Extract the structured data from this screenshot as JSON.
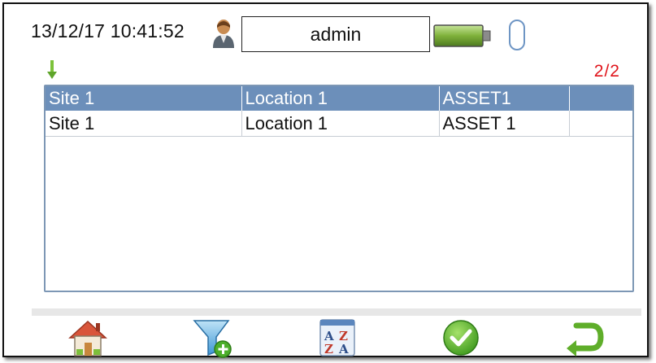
{
  "status_bar": {
    "datetime": "13/12/17 10:41:52",
    "username": "admin",
    "icons": [
      "user-icon",
      "battery-icon",
      "signal-icon"
    ]
  },
  "list": {
    "page_indicator": "2/2",
    "columns": [
      "Site 1",
      "Location 1",
      "ASSET1",
      ""
    ],
    "rows": [
      [
        "Site 1",
        "Location 1",
        "ASSET 1",
        ""
      ]
    ]
  },
  "toolbar": {
    "buttons": [
      "home-icon",
      "add-filter-icon",
      "sort-az-icon",
      "confirm-icon",
      "back-icon"
    ]
  },
  "colors": {
    "header_bg": "#6c8fba",
    "page_indicator": "#e0141b",
    "battery": "#7fb13a",
    "confirm": "#5cb82e",
    "back": "#5fae2a"
  }
}
